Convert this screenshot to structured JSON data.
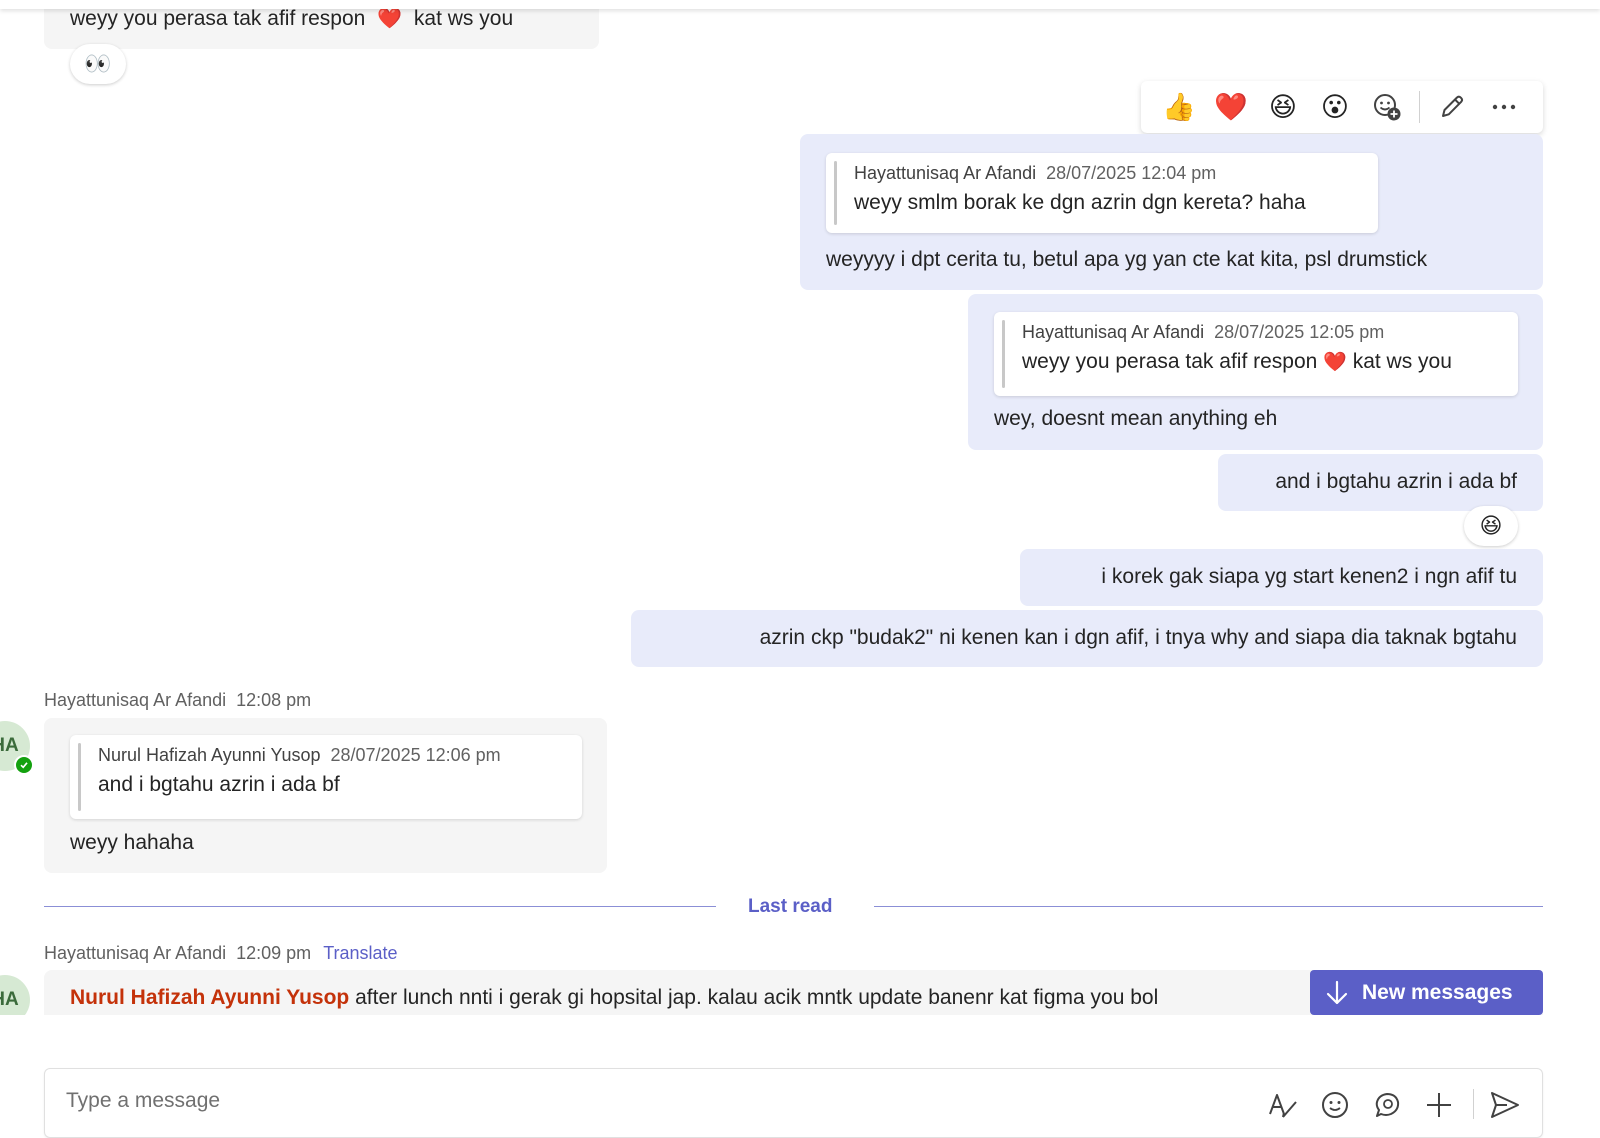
{
  "messages": {
    "m1": {
      "text_before": "weyy you perasa tak afif respon",
      "emoji": "❤️",
      "text_after": "kat ws you",
      "reaction": "👀"
    },
    "m2": {
      "quote": {
        "author": "Hayattunisaq Ar Afandi",
        "time": "28/07/2025 12:04 pm",
        "text": "weyy smlm borak ke dgn azrin dgn kereta? haha"
      },
      "text": "weyyyy i dpt cerita tu, betul apa yg yan cte kat kita, psl drumstick"
    },
    "m3": {
      "quote": {
        "author": "Hayattunisaq Ar Afandi",
        "time": "28/07/2025 12:05 pm",
        "text_before": "weyy you perasa tak afif respon",
        "emoji": "❤️",
        "text_after": "kat ws you"
      },
      "text": "wey, doesnt mean anything eh"
    },
    "m4": {
      "text": "and i bgtahu azrin i ada bf",
      "reaction": "😆"
    },
    "m5": {
      "text": "i korek gak siapa yg start kenen2 i ngn afif tu"
    },
    "m6": {
      "text": "azrin ckp \"budak2\" ni kenen kan i dgn afif, i tnya why and siapa dia taknak bgtahu"
    },
    "m7": {
      "author": "Hayattunisaq Ar Afandi",
      "time": "12:08 pm",
      "avatar_initials": "HA",
      "quote": {
        "author": "Nurul Hafizah Ayunni Yusop",
        "time": "28/07/2025 12:06 pm",
        "text": "and i bgtahu azrin i ada bf"
      },
      "text": "weyy hahaha"
    },
    "m8": {
      "author": "Hayattunisaq Ar Afandi",
      "time": "12:09 pm",
      "translate": "Translate",
      "avatar_initials": "HA",
      "mention": "Nurul Hafizah Ayunni Yusop",
      "text": "after lunch nnti i gerak gi hopsital jap. kalau acik mntk update banenr kat figma you bol"
    }
  },
  "hover_bar": {
    "reactions": [
      "👍",
      "❤️",
      "😆",
      "😮"
    ],
    "icons": [
      "add-reaction-icon",
      "edit-icon",
      "more-options-icon"
    ]
  },
  "last_read": "Last read",
  "new_messages": "New messages",
  "composer": {
    "placeholder": "Type a message",
    "icons": [
      "format-icon",
      "emoji-icon",
      "loop-icon",
      "attach-plus-icon",
      "send-icon"
    ]
  }
}
